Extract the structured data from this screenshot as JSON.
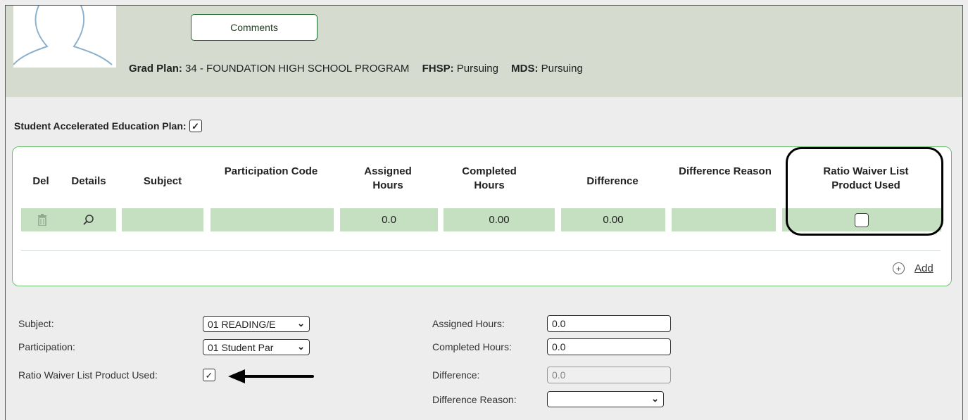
{
  "header": {
    "comments_label": "Comments",
    "grad_plan_label": "Grad Plan:",
    "grad_plan_value": "34 - FOUNDATION HIGH SCHOOL PROGRAM",
    "fhsp_label": "FHSP:",
    "fhsp_value": "Pursuing",
    "mds_label": "MDS:",
    "mds_value": "Pursuing"
  },
  "saep": {
    "label": "Student Accelerated Education Plan:",
    "checked": true
  },
  "grid": {
    "columns": [
      "Del",
      "Details",
      "Subject",
      "Participation Code",
      "Assigned Hours",
      "Completed Hours",
      "Difference",
      "Difference Reason",
      "Ratio Waiver List Product Used"
    ],
    "rows": [
      {
        "subject": "",
        "participation_code": "",
        "assigned_hours": "0.0",
        "completed_hours": "0.00",
        "difference": "0.00",
        "difference_reason": "",
        "ratio_waiver": false
      }
    ],
    "add_label": "Add"
  },
  "form": {
    "subject_label": "Subject:",
    "subject_value": "01  READING/E",
    "participation_label": "Participation:",
    "participation_value": "01  Student Par",
    "ratio_waiver_label": "Ratio Waiver List Product Used:",
    "ratio_waiver_checked": true,
    "assigned_hours_label": "Assigned Hours:",
    "assigned_hours_value": "0.0",
    "completed_hours_label": "Completed Hours:",
    "completed_hours_value": "0.0",
    "difference_label": "Difference:",
    "difference_value": "0.0",
    "difference_reason_label": "Difference Reason:",
    "difference_reason_value": ""
  },
  "colors": {
    "header_bg": "#d6dbcf",
    "row_green": "#c5dfc1",
    "border_green": "#6cc06f"
  },
  "icons": {
    "delete": "trash-icon",
    "details": "search-icon",
    "add": "plus-circle-icon",
    "avatar": "user-silhouette-icon",
    "annotation": "arrow-left-icon"
  }
}
